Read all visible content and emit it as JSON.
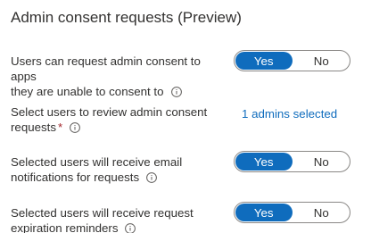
{
  "section": {
    "title": "Admin consent requests (Preview)"
  },
  "rows": [
    {
      "label_line1": "Users can request admin consent to apps",
      "label_line2": "they are unable to consent to",
      "toggle": {
        "on_label": "Yes",
        "off_label": "No",
        "selected": "Yes"
      }
    },
    {
      "label_line1": "Select users to review admin consent",
      "label_line2": "requests",
      "required_mark": "*",
      "link": "1 admins selected"
    },
    {
      "label_line1": "Selected users will receive email",
      "label_line2": "notifications for requests",
      "toggle": {
        "on_label": "Yes",
        "off_label": "No",
        "selected": "Yes"
      }
    },
    {
      "label_line1": "Selected users will receive request",
      "label_line2": "expiration reminders",
      "toggle": {
        "on_label": "Yes",
        "off_label": "No",
        "selected": "Yes"
      }
    }
  ],
  "colors": {
    "accent": "#0f6cbd",
    "required": "#a4262c",
    "text": "#323130"
  },
  "icons": {
    "info": "info-icon"
  }
}
